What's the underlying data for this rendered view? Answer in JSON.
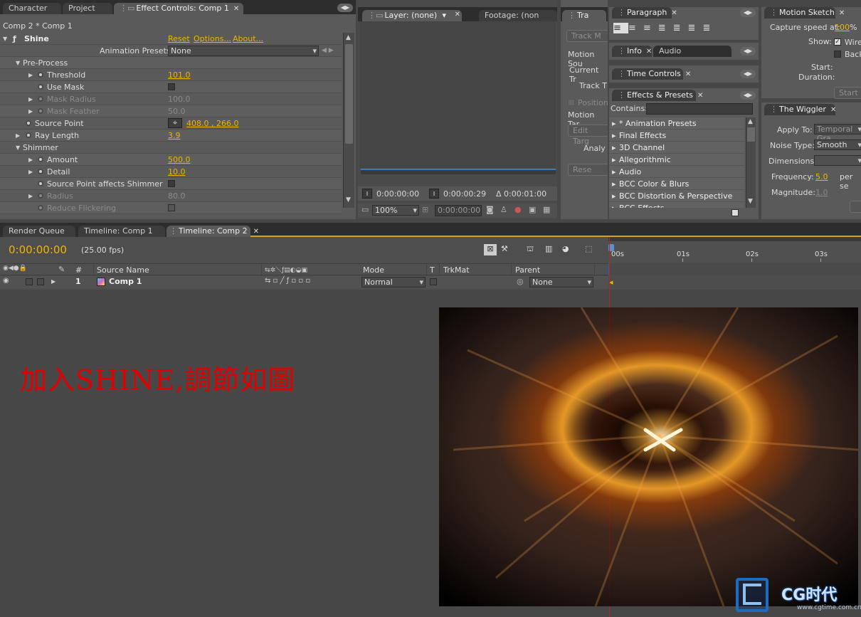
{
  "top_tabs": {
    "character": "Character",
    "project": "Project",
    "effect_controls": "Effect Controls: Comp 1"
  },
  "effect": {
    "breadcrumb": "Comp 2 * Comp 1",
    "name": "Shine",
    "links": {
      "reset": "Reset",
      "options": "Options...",
      "about": "About..."
    },
    "presets_label": "Animation Presets:",
    "presets_value": "None",
    "rows": [
      {
        "label": "Pre-Process",
        "value": ""
      },
      {
        "label": "Threshold",
        "value": "101.0"
      },
      {
        "label": "Use Mask",
        "value": ""
      },
      {
        "label": "Mask Radius",
        "value": "100.0"
      },
      {
        "label": "Mask Feather",
        "value": "50.0"
      },
      {
        "label": "Source Point",
        "value": "408.0 , 266.0"
      },
      {
        "label": "Ray Length",
        "value": "3.9"
      },
      {
        "label": "Shimmer",
        "value": ""
      },
      {
        "label": "Amount",
        "value": "500.0"
      },
      {
        "label": "Detail",
        "value": "10.0"
      },
      {
        "label": "Source Point affects Shimmer",
        "value": ""
      },
      {
        "label": "Radius",
        "value": "80.0"
      },
      {
        "label": "Reduce Flickering",
        "value": ""
      }
    ]
  },
  "layer_panel": {
    "tab_layer": "Layer: (none)",
    "tab_footage": "Footage: (non",
    "time_start": "0:00:00:00",
    "time_end": "0:00:00:29",
    "duration": "Δ 0:00:01:00",
    "zoom": "100%",
    "timecode": "0:00:00:00"
  },
  "tracker": {
    "tab": "Tra",
    "track_btn": "Track M",
    "motion_source": "Motion Sou",
    "current_track": "Current Tr",
    "track_type": "Track T",
    "position": "Position",
    "motion_target": "Motion Tar",
    "edit_target": "Edit Targ",
    "analyze": "Analy",
    "reset": "Rese"
  },
  "paragraph": {
    "tab": "Paragraph"
  },
  "info": {
    "tab": "Info",
    "audio_tab": "Audio"
  },
  "time_controls": {
    "tab": "Time Controls"
  },
  "effects_presets": {
    "tab": "Effects & Presets",
    "contains_label": "Contains:",
    "items": [
      "* Animation Presets",
      "Final Effects",
      "3D Channel",
      "Allegorithmic",
      "Audio",
      "BCC Color & Blurs",
      "BCC Distortion & Perspective",
      "BCC Effects"
    ]
  },
  "motion_sketch": {
    "tab": "Motion Sketch",
    "capture_label": "Capture speed at:",
    "capture_value": "100",
    "capture_unit": "%",
    "show_label": "Show:",
    "wireframe": "Wirefr",
    "background": "Backg",
    "start_label": "Start:",
    "duration_label": "Duration:",
    "start_btn": "Start"
  },
  "wiggler": {
    "tab": "The Wiggler",
    "apply_to_label": "Apply To:",
    "apply_to_value": "Temporal Gra",
    "noise_label": "Noise Type:",
    "noise_value": "Smooth",
    "dimensions_label": "Dimensions:",
    "frequency_label": "Frequency:",
    "frequency_value": "5.0",
    "frequency_unit": "per se",
    "magnitude_label": "Magnitude:",
    "magnitude_value": "1.0"
  },
  "timeline": {
    "tabs": [
      "Render Queue",
      "Timeline: Comp 1",
      "Timeline: Comp 2"
    ],
    "timecode": "0:00:00:00",
    "fps": "(25.00 fps)",
    "col_hash": "#",
    "col_source": "Source Name",
    "col_mode": "Mode",
    "col_t": "T",
    "col_trkmat": "TrkMat",
    "col_parent": "Parent",
    "layer_index": "1",
    "layer_name": "Comp 1",
    "layer_mode": "Normal",
    "layer_parent": "None",
    "ruler": [
      "00s",
      "01s",
      "02s",
      "03s"
    ]
  },
  "annotation": "加入SHINE,調節如圖",
  "watermark": {
    "brand": "CG时代",
    "url": "www.cgtime.com.cn"
  },
  "colors": {
    "accent": "#f0b400",
    "annotation": "#e00000",
    "panel": "#5a5a5a",
    "background": "#474747"
  }
}
